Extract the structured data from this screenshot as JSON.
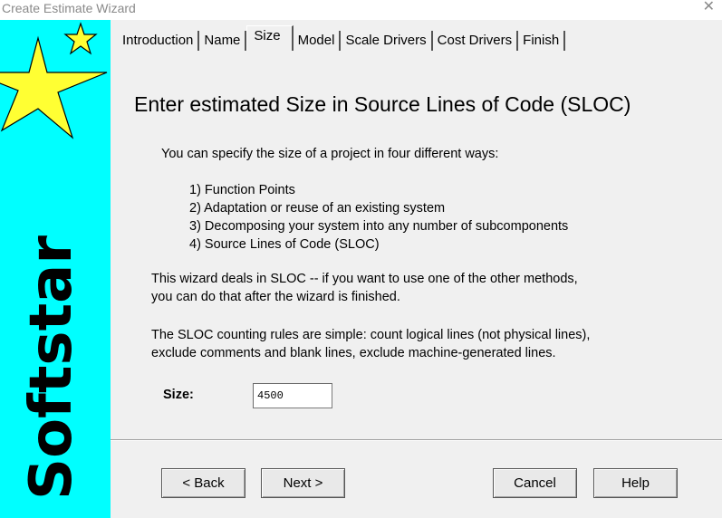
{
  "window": {
    "title": "Create Estimate Wizard",
    "close_glyph": "✕"
  },
  "sidebar": {
    "brand": "Softstar",
    "background": "#00ffff",
    "star_color": "#ffff33"
  },
  "tabs": [
    {
      "label": "Introduction",
      "active": false
    },
    {
      "label": "Name",
      "active": false
    },
    {
      "label": "Size",
      "active": true
    },
    {
      "label": "Model",
      "active": false
    },
    {
      "label": "Scale Drivers",
      "active": false
    },
    {
      "label": "Cost Drivers",
      "active": false
    },
    {
      "label": "Finish",
      "active": false
    }
  ],
  "content": {
    "heading": "Enter estimated Size in Source Lines of Code (SLOC)",
    "intro": "You can specify the size of a project in four different ways:",
    "methods": [
      "1) Function Points",
      "2) Adaptation or reuse of an existing system",
      "3) Decomposing your system into any number of subcomponents",
      "4) Source Lines of Code (SLOC)"
    ],
    "para2_line1": "This wizard deals in SLOC -- if you want to use one of the other methods,",
    "para2_line2": "you can do that after the wizard is finished.",
    "para3_line1": "The SLOC counting rules are simple: count logical lines (not physical lines),",
    "para3_line2": "exclude comments and blank lines, exclude machine-generated lines."
  },
  "size": {
    "label": "Size:",
    "value": "4500"
  },
  "buttons": {
    "back": "< Back",
    "next": "Next >",
    "cancel": "Cancel",
    "help": "Help"
  }
}
